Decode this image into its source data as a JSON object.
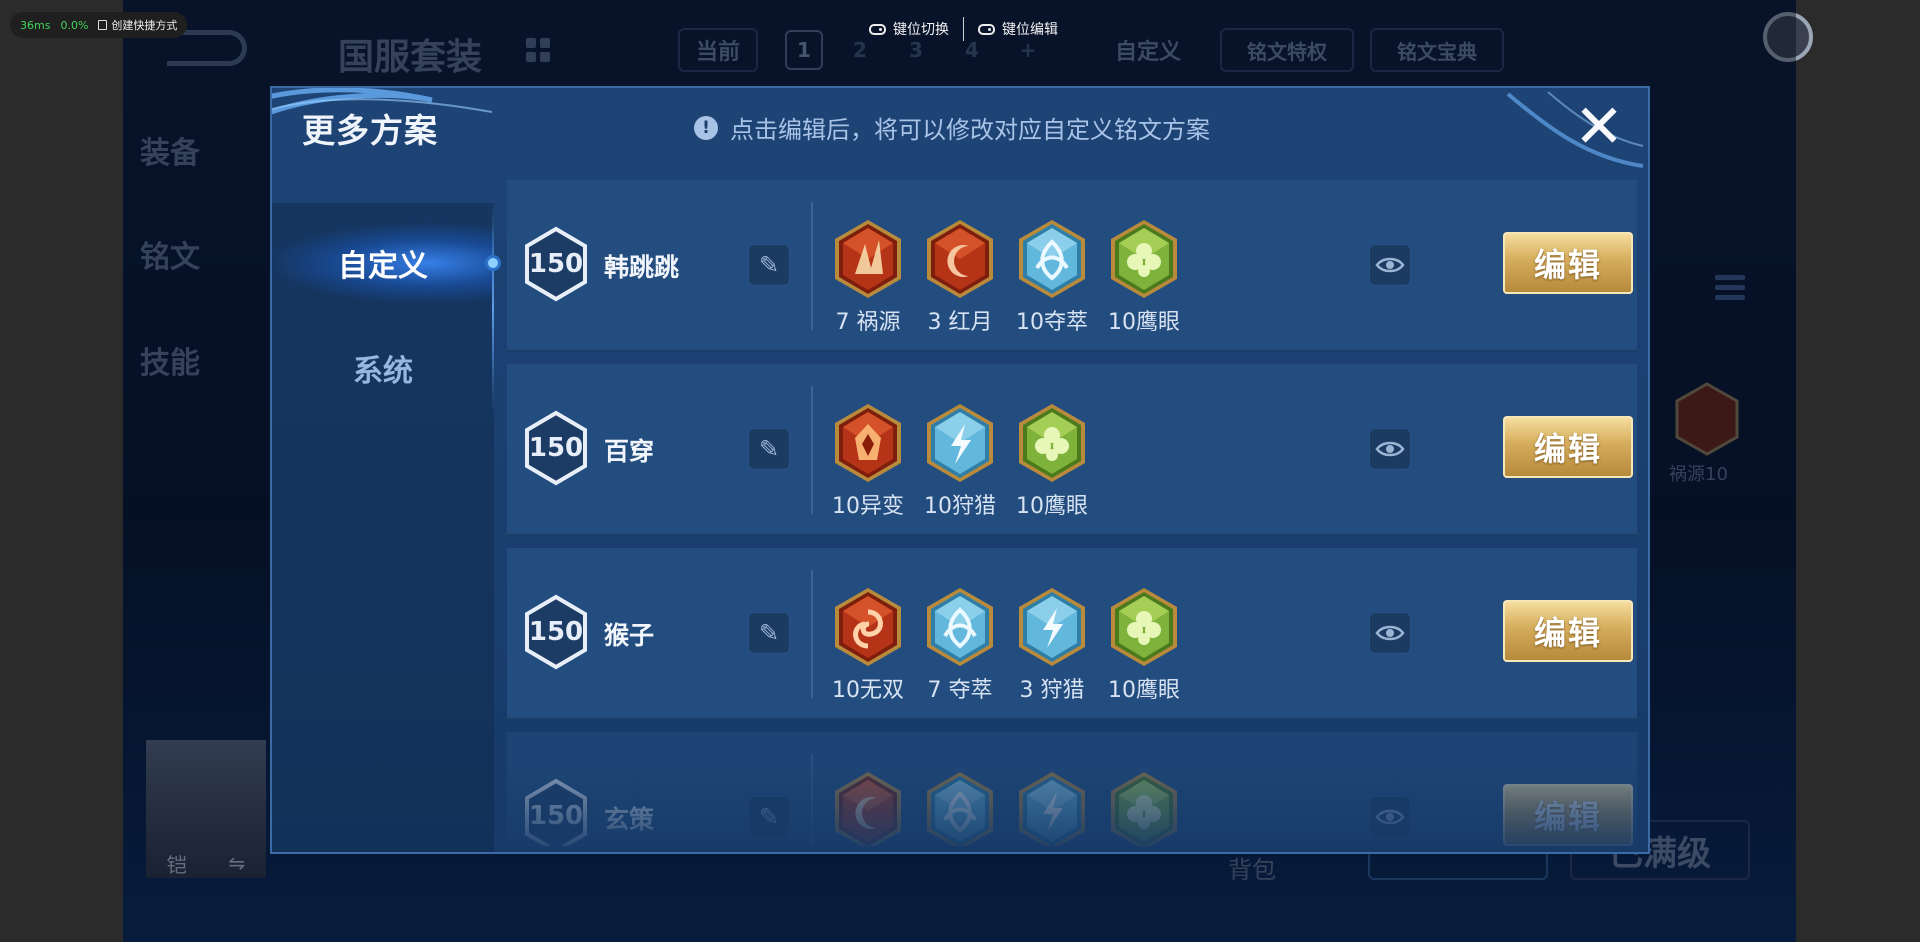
{
  "emulator": {
    "latency": "36ms",
    "loss": "0.0%",
    "shortcut_label": "创建快捷方式",
    "keymap_switch": "键位切换",
    "keymap_edit": "键位编辑"
  },
  "background": {
    "suit_title": "国服套装",
    "side_tabs": [
      "装备",
      "铭文",
      "技能"
    ],
    "current_label": "当前",
    "plan_numbers": [
      "1",
      "2",
      "3",
      "4",
      "+"
    ],
    "custom_label": "自定义",
    "rune_privilege": "铭文特权",
    "rune_codex": "铭文宝典",
    "hero_name": "铠",
    "backpack": "背包",
    "max_level": "已满级",
    "side_rune_label": "祸源10"
  },
  "dialog": {
    "title": "更多方案",
    "hint": "点击编辑后，将可以修改对应自定义铭文方案",
    "close_symbol": "✕",
    "tabs": {
      "custom": "自定义",
      "system": "系统"
    },
    "plans": [
      {
        "level": "150",
        "name": "韩跳跳",
        "edit_label": "编辑",
        "runes": [
          {
            "label": "7 祸源",
            "color": "red",
            "icon": "rune-shards"
          },
          {
            "label": "3 红月",
            "color": "red",
            "icon": "rune-moon"
          },
          {
            "label": "10夺萃",
            "color": "blue",
            "icon": "rune-knot"
          },
          {
            "label": "10鹰眼",
            "color": "green",
            "icon": "rune-clover"
          }
        ]
      },
      {
        "level": "150",
        "name": "百穿",
        "edit_label": "编辑",
        "runes": [
          {
            "label": "10异变",
            "color": "red",
            "icon": "rune-flame"
          },
          {
            "label": "10狩猎",
            "color": "blue",
            "icon": "rune-bolt"
          },
          {
            "label": "10鹰眼",
            "color": "green",
            "icon": "rune-clover"
          }
        ]
      },
      {
        "level": "150",
        "name": "猴子",
        "edit_label": "编辑",
        "runes": [
          {
            "label": "10无双",
            "color": "red",
            "icon": "rune-swirl"
          },
          {
            "label": "7 夺萃",
            "color": "blue",
            "icon": "rune-knot"
          },
          {
            "label": "3 狩猎",
            "color": "blue",
            "icon": "rune-bolt"
          },
          {
            "label": "10鹰眼",
            "color": "green",
            "icon": "rune-clover"
          }
        ]
      },
      {
        "level": "150",
        "name": "玄策",
        "edit_label": "编辑",
        "runes": [
          {
            "label": "",
            "color": "red",
            "icon": "rune-moon"
          },
          {
            "label": "",
            "color": "blue",
            "icon": "rune-knot"
          },
          {
            "label": "",
            "color": "blue",
            "icon": "rune-bolt"
          },
          {
            "label": "",
            "color": "green",
            "icon": "rune-clover"
          }
        ]
      }
    ]
  },
  "colors": {
    "dialog_bg": "#1e4476",
    "row_bg": "#234d7e",
    "edit_gold": "#d5ac5b",
    "rune_red": "#c9431f",
    "rune_blue": "#62b7dc",
    "rune_green": "#7fb23a"
  }
}
